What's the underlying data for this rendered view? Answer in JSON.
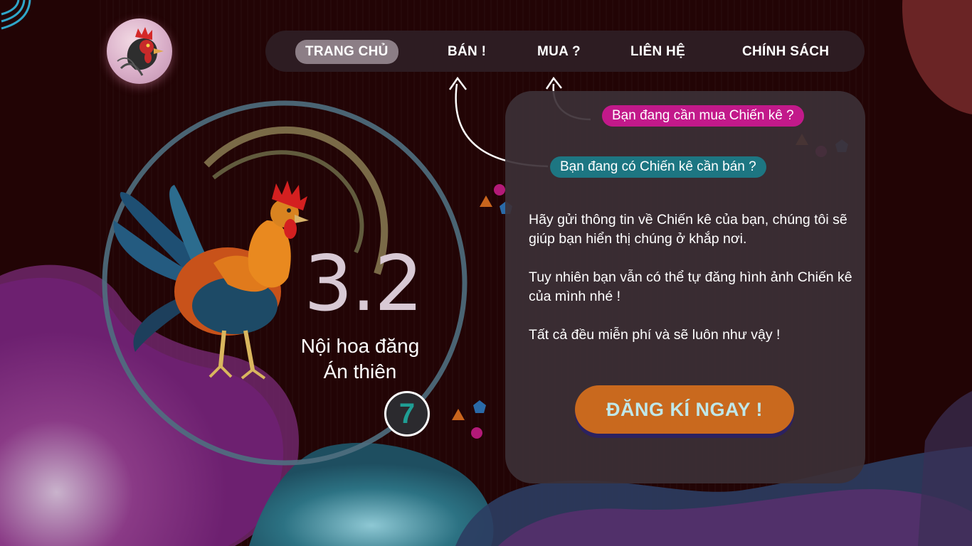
{
  "nav": {
    "items": [
      {
        "label": "TRANG CHỦ",
        "active": true
      },
      {
        "label": "BÁN !",
        "active": false
      },
      {
        "label": "MUA ?",
        "active": false
      },
      {
        "label": "LIÊN HỆ",
        "active": false
      },
      {
        "label": "CHÍNH SÁCH",
        "active": false
      }
    ]
  },
  "bubbles": {
    "buy": "Bạn đang cần mua Chiến kê ?",
    "sell": "Bạn đang có Chiến kê cần bán ?"
  },
  "card": {
    "paragraphs": [
      "Hãy gửi thông tin về Chiến kê của bạn, chúng tôi sẽ giúp bạn hiển thị chúng ở khắp nơi.",
      "Tuy nhiên bạn vẫn có thể tự đăng hình ảnh Chiến kê của mình nhé !",
      "Tất cả đều miễn phí và sẽ luôn như vậy !"
    ],
    "cta": "ĐĂNG KÍ NGAY !"
  },
  "hero": {
    "number": "3.2",
    "line1": "Nội hoa đăng",
    "line2": "Án thiên",
    "badge": "7"
  },
  "colors": {
    "background": "#220405",
    "buy_bubble": "#c2198a",
    "sell_bubble": "#1d7682",
    "cta": "#c9691e",
    "nav_active": "#8c7e86"
  },
  "icons": {
    "logo": "rooster-logo-icon",
    "hero": "rooster-illustration"
  }
}
